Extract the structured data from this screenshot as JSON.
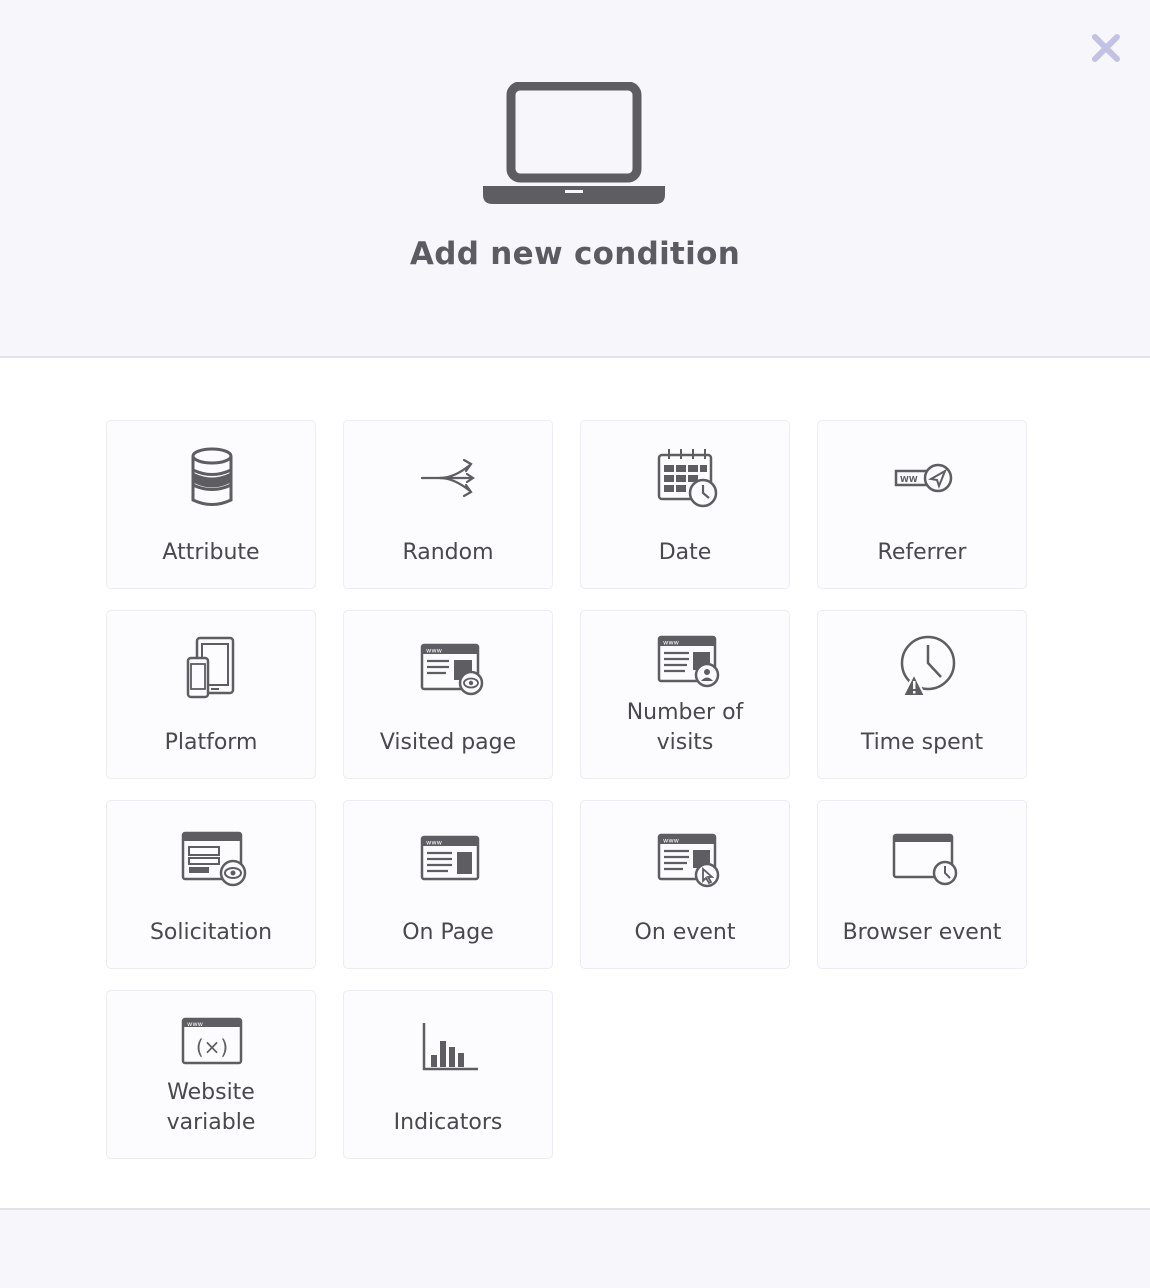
{
  "dialog": {
    "title": "Add new condition",
    "close_icon": "close-icon",
    "header_icon": "laptop-icon",
    "accent_color": "#c3c1e4"
  },
  "conditions": [
    {
      "label": "Attribute",
      "icon": "database-icon"
    },
    {
      "label": "Random",
      "icon": "split-arrows-icon"
    },
    {
      "label": "Date",
      "icon": "calendar-clock-icon"
    },
    {
      "label": "Referrer",
      "icon": "www-send-icon"
    },
    {
      "label": "Platform",
      "icon": "devices-icon"
    },
    {
      "label": "Visited page",
      "icon": "webpage-eye-icon"
    },
    {
      "label": "Number of visits",
      "icon": "webpage-user-icon"
    },
    {
      "label": "Time spent",
      "icon": "clock-warning-icon"
    },
    {
      "label": "Solicitation",
      "icon": "window-eye-icon"
    },
    {
      "label": "On Page",
      "icon": "webpage-icon"
    },
    {
      "label": "On event",
      "icon": "webpage-cursor-icon"
    },
    {
      "label": "Browser event",
      "icon": "browser-clock-icon"
    },
    {
      "label": "Website variable",
      "icon": "webpage-variable-icon"
    },
    {
      "label": "Indicators",
      "icon": "bar-chart-icon"
    }
  ]
}
